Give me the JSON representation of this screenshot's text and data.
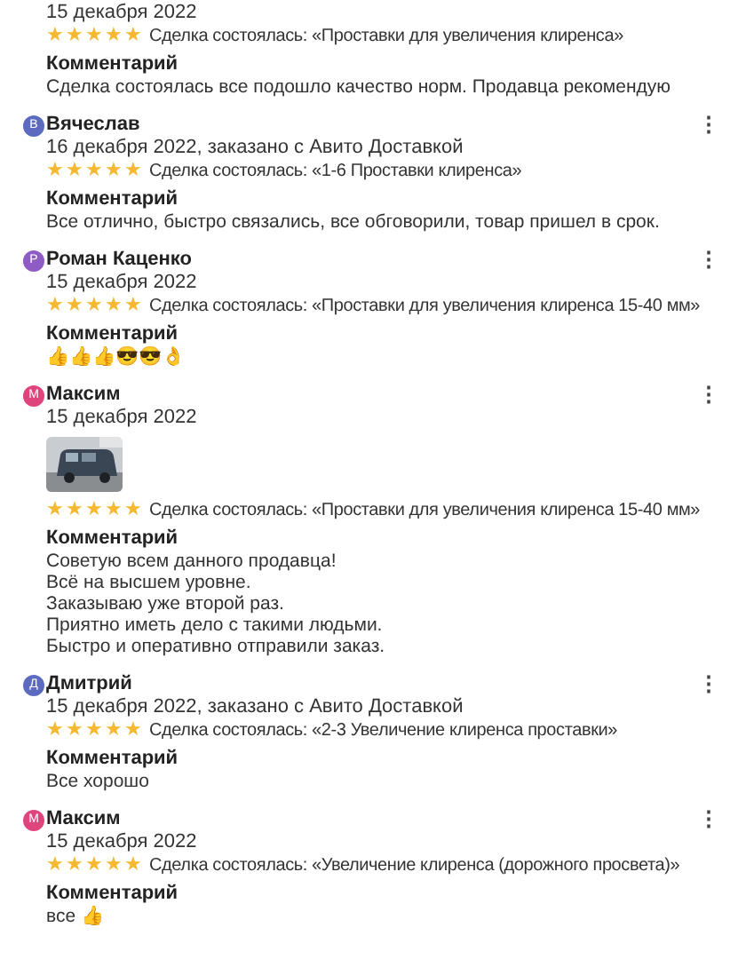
{
  "reviews": [
    {
      "date": "15 декабря 2022",
      "stars": 5,
      "deal": "Сделка состоялась: «Проставки для увеличения клиренса»",
      "comment_title": "Комментарий",
      "comment": [
        "Сделка состоялась все подошло качество норм. Продавца рекомендую"
      ]
    },
    {
      "avatar": "В",
      "color": "#5c6bc0",
      "name": "Вячеслав",
      "menu": "⋮",
      "date": "16 декабря 2022, заказано с Авито Доставкой",
      "stars": 5,
      "deal": "Сделка состоялась: «1-6 Проставки клиренса»",
      "comment_title": "Комментарий",
      "comment": [
        "Все отлично, быстро связались, все обговорили, товар пришел в срок."
      ]
    },
    {
      "avatar": "Р",
      "color": "#8e5cc4",
      "name": "Роман Каценко",
      "menu": "⋮",
      "date": "15 декабря 2022",
      "stars": 5,
      "deal": "Сделка состоялась: «Проставки для увеличения клиренса 15-40 мм»",
      "comment_title": "Комментарий",
      "comment": [
        "👍👍👍😎😎👌"
      ]
    },
    {
      "avatar": "М",
      "color": "#e0447c",
      "name": "Максим",
      "menu": "⋮",
      "date": "15 декабря 2022",
      "photo": {
        "kind": "picture"
      },
      "stars": 5,
      "deal": "Сделка состоялась: «Проставки для увеличения клиренса 15-40 мм»",
      "comment_title": "Комментарий",
      "comment": [
        "Советую всем данного продавца!",
        "Всё на высшем уровне.",
        "Заказываю уже второй раз.",
        "Приятно иметь дело с такими людьми.",
        "Быстро и оперативно отправили заказ."
      ]
    },
    {
      "avatar": "Д",
      "color": "#5c6bc0",
      "name": "Дмитрий",
      "menu": "⋮",
      "date": "15 декабря 2022, заказано с Авито Доставкой",
      "stars": 5,
      "deal": "Сделка состоялась: «2-3 Увеличение клиренса проставки»",
      "comment_title": "Комментарий",
      "comment": [
        "Все хорошо"
      ]
    },
    {
      "avatar": "М",
      "color": "#e0447c",
      "name": "Максим",
      "menu": "⋮",
      "date": "15 декабря 2022",
      "stars": 5,
      "deal": "Сделка состоялась: «Увеличение клиренса (дорожного просвета)»",
      "comment_title": "Комментарий",
      "comment": [
        "все 👍"
      ]
    }
  ]
}
